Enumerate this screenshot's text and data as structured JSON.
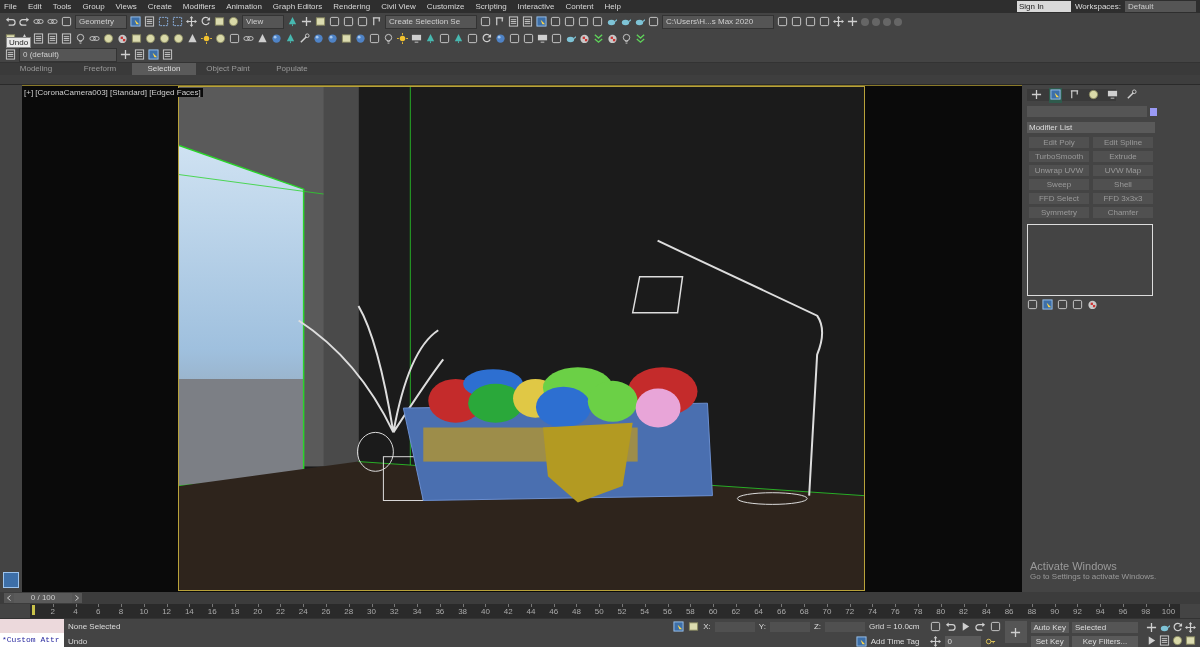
{
  "menu_bar": [
    "File",
    "Edit",
    "Tools",
    "Group",
    "Views",
    "Create",
    "Modifiers",
    "Animation",
    "Graph Editors",
    "Rendering",
    "Civil View",
    "Customize",
    "Scripting",
    "Interactive",
    "Content",
    "Help"
  ],
  "account": {
    "sign_in": "Sign In",
    "workspaces_label": "Workspaces:",
    "workspace": "Default"
  },
  "toolbar": {
    "selection_filter": "Geometry",
    "reference_coord": "View",
    "named_selection": "Create Selection Se",
    "project_path": "C:\\Users\\H...s Max 2020",
    "layer": "0 (default)",
    "tooltip": "Undo"
  },
  "ribbon_tabs": [
    {
      "label": "Modeling",
      "selected": false
    },
    {
      "label": "Freeform",
      "selected": false
    },
    {
      "label": "Selection",
      "selected": true
    },
    {
      "label": "Object Paint",
      "selected": false
    },
    {
      "label": "Populate",
      "selected": false
    }
  ],
  "viewport": {
    "label": "[+] [CoronaCamera003] [Standard] [Edged Faces]"
  },
  "command_panel": {
    "tabs": [
      {
        "kind": "create",
        "selected": false
      },
      {
        "kind": "modify",
        "selected": true
      },
      {
        "kind": "hierarchy",
        "selected": false
      },
      {
        "kind": "motion",
        "selected": false
      },
      {
        "kind": "display",
        "selected": false
      },
      {
        "kind": "utilities",
        "selected": false
      }
    ],
    "modifier_list": "Modifier List",
    "modifier_buttons": [
      "Edit Poly",
      "Edit Spline",
      "TurboSmooth",
      "Extrude",
      "Unwrap UVW",
      "UVW Map",
      "Sweep",
      "Shell",
      "FFD Select",
      "FFD 3x3x3",
      "Symmetry",
      "Chamfer"
    ]
  },
  "time_slider": "0 / 100",
  "timeline_labels": [
    "2",
    "4",
    "6",
    "8",
    "10",
    "12",
    "14",
    "16",
    "18",
    "20",
    "22",
    "24",
    "26",
    "28",
    "30",
    "32",
    "34",
    "36",
    "38",
    "40",
    "42",
    "44",
    "46",
    "48",
    "50",
    "52",
    "54",
    "56",
    "58",
    "60",
    "62",
    "64",
    "66",
    "68",
    "70",
    "72",
    "74",
    "76",
    "78",
    "80",
    "82",
    "84",
    "86",
    "88",
    "90",
    "92",
    "94",
    "96",
    "98",
    "100"
  ],
  "status_bar": {
    "listener": "*Custom Attr",
    "selection": "None Selected",
    "prompt": "Undo",
    "x_label": "X:",
    "y_label": "Y:",
    "z_label": "Z:",
    "grid": "Grid = 10.0cm",
    "add_time_tag": "Add Time Tag",
    "frame": "0",
    "auto_key": "Auto Key",
    "key_mode": "Selected",
    "set_key": "Set Key",
    "key_filters": "Key Filters..."
  },
  "watermark_notice": {
    "title": "Activate Windows",
    "message": "Go to Settings to activate Windows."
  }
}
